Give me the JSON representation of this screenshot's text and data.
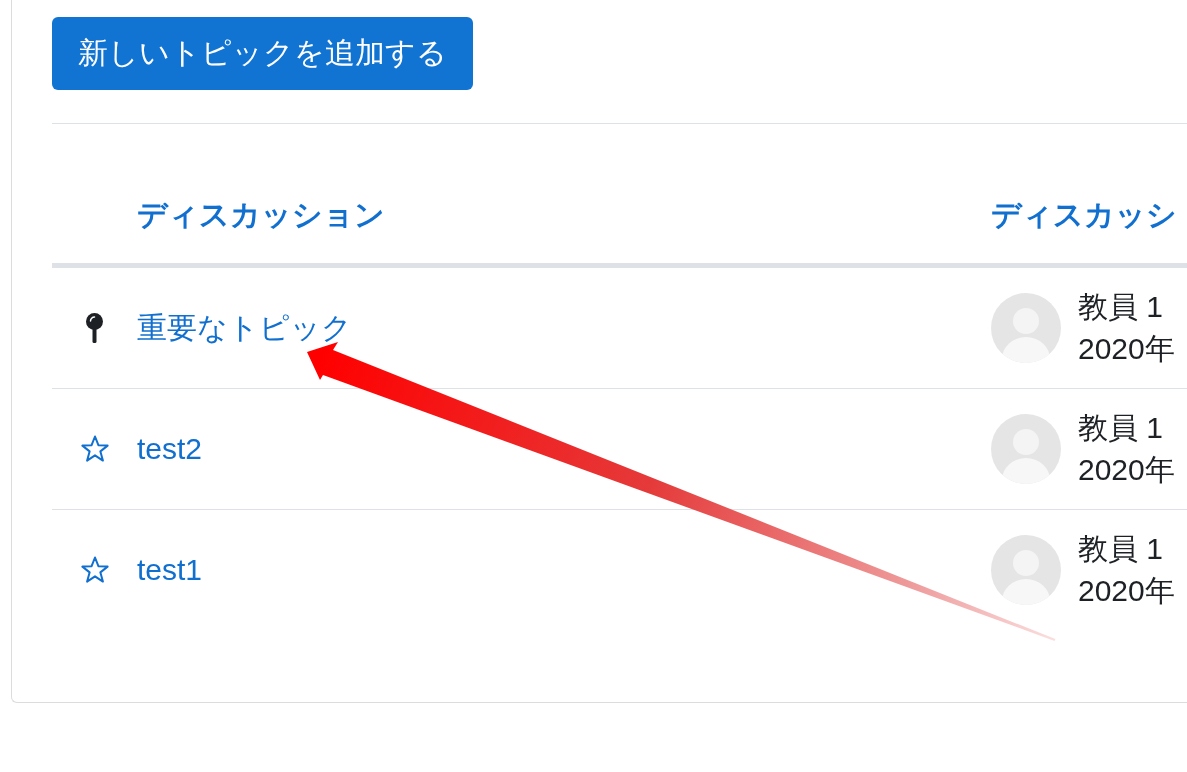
{
  "add_button": {
    "label": "新しいトピックを追加する"
  },
  "table": {
    "columns": [
      "ディスカッション",
      "ディスカッシ"
    ],
    "rows": [
      {
        "pinned": true,
        "topic": "重要なトピック",
        "author": "教員 1",
        "date": "2020年"
      },
      {
        "pinned": false,
        "topic": "test2",
        "author": "教員 1",
        "date": "2020年"
      },
      {
        "pinned": false,
        "topic": "test1",
        "author": "教員 1",
        "date": "2020年"
      }
    ]
  },
  "annotations": [
    {
      "kind": "arrow"
    }
  ]
}
